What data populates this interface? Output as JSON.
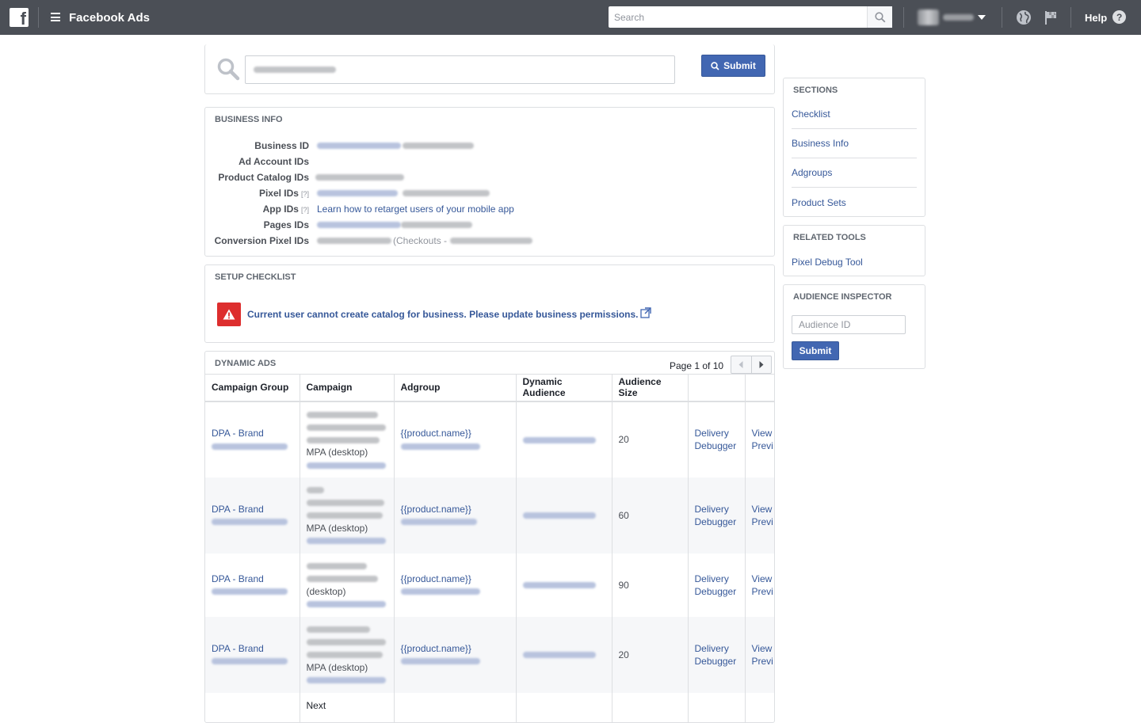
{
  "topbar": {
    "app_title": "Facebook Ads",
    "search_placeholder": "Search",
    "help_label": "Help",
    "help_glyph": "?",
    "logo_glyph": "f"
  },
  "main_search": {
    "submit_label": "Submit"
  },
  "business_info": {
    "heading": "BUSINESS INFO",
    "rows": [
      {
        "label": "Business ID",
        "help": ""
      },
      {
        "label": "Ad Account IDs",
        "help": ""
      },
      {
        "label": "Product Catalog IDs",
        "help": ""
      },
      {
        "label": "Pixel IDs",
        "help": "[?]"
      },
      {
        "label": "App IDs",
        "help": "[?]",
        "link": "Learn how to retarget users of your mobile app"
      },
      {
        "label": "Pages IDs",
        "help": ""
      },
      {
        "label": "Conversion Pixel IDs",
        "help": "",
        "suffix": "(Checkouts -"
      }
    ]
  },
  "setup_checklist": {
    "heading": "SETUP CHECKLIST",
    "warning": "Current user cannot create catalog for business. Please update business permissions."
  },
  "dynamic_ads": {
    "heading": "DYNAMIC ADS",
    "pager": "Page 1 of 10",
    "columns": [
      "Campaign Group",
      "Campaign",
      "Adgroup",
      "Dynamic Audience",
      "Audience Size",
      "",
      ""
    ],
    "rows": [
      {
        "group": "DPA - Brand",
        "campaign_tail": "MPA (desktop)",
        "adgroup": "{{product.name}}",
        "size": "20",
        "action1a": "Delivery",
        "action1b": "Debugger",
        "action2a": "View",
        "action2b": "Previ"
      },
      {
        "group": "DPA - Brand",
        "campaign_tail": "MPA (desktop)",
        "adgroup": "{{product.name}}",
        "size": "60",
        "action1a": "Delivery",
        "action1b": "Debugger",
        "action2a": "View",
        "action2b": "Previ"
      },
      {
        "group": "DPA - Brand",
        "campaign_tail": "(desktop)",
        "adgroup": "{{product.name}}",
        "size": "90",
        "action1a": "Delivery",
        "action1b": "Debugger",
        "action2a": "View",
        "action2b": "Previ"
      },
      {
        "group": "DPA - Brand",
        "campaign_tail": "MPA (desktop)",
        "adgroup": "{{product.name}}",
        "size": "20",
        "action1a": "Delivery",
        "action1b": "Debugger",
        "action2a": "View",
        "action2b": "Previ"
      },
      {
        "group": "",
        "campaign_tail": "Next",
        "adgroup": "",
        "size": "",
        "action1a": "",
        "action1b": "",
        "action2a": "",
        "action2b": ""
      }
    ]
  },
  "sidebar": {
    "sections_heading": "SECTIONS",
    "sections": [
      "Checklist",
      "Business Info",
      "Adgroups",
      "Product Sets"
    ],
    "tools_heading": "RELATED TOOLS",
    "tools": [
      "Pixel Debug Tool"
    ],
    "inspector_heading": "AUDIENCE INSPECTOR",
    "inspector_placeholder": "Audience ID",
    "inspector_submit": "Submit"
  },
  "colors": {
    "topbar": "#4b4f56",
    "link": "#365899",
    "button": "#4267b2",
    "warning": "#dd2e2e"
  }
}
